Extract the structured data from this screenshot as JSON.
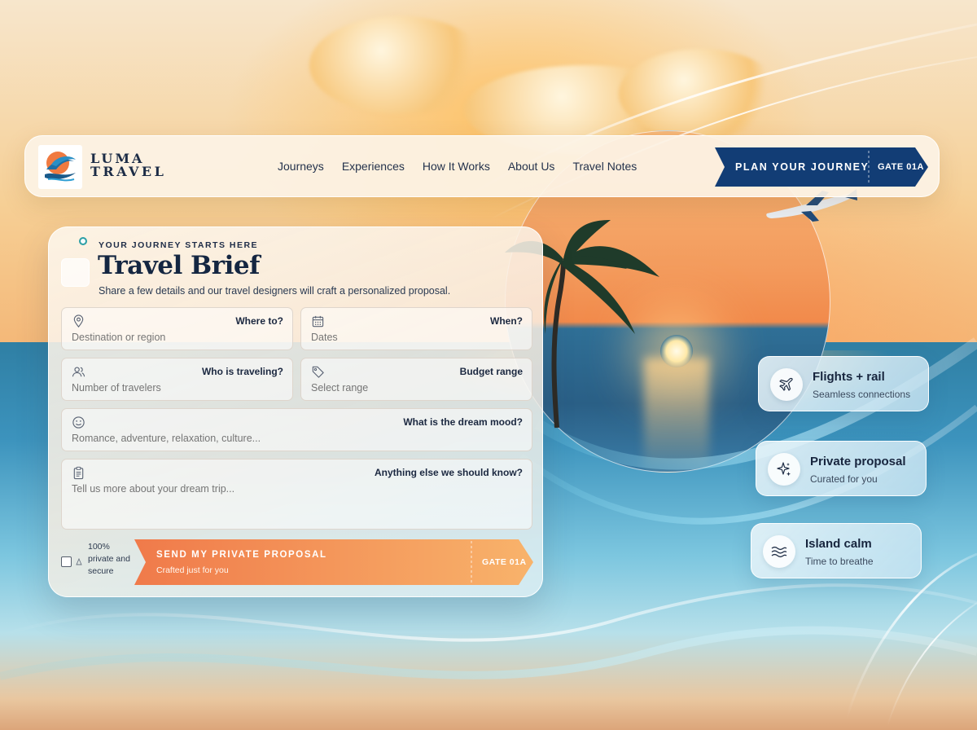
{
  "brand": {
    "line1": "LUMA",
    "line2": "TRAVEL"
  },
  "nav": {
    "items": [
      {
        "label": "Journeys"
      },
      {
        "label": "Experiences"
      },
      {
        "label": "How It Works"
      },
      {
        "label": "About Us"
      },
      {
        "label": "Travel Notes"
      }
    ]
  },
  "header_cta": {
    "label": "PLAN YOUR JOURNEY",
    "gate": "GATE 01A",
    "color": "#123d75"
  },
  "brief": {
    "eyebrow": "YOUR JOURNEY STARTS HERE",
    "title": "Travel Brief",
    "subtitle": "Share a few details and our travel designers will craft a personalized proposal.",
    "fields": {
      "where": {
        "label": "Where to?",
        "placeholder": "Destination or region",
        "icon": "map-pin-icon"
      },
      "when": {
        "label": "When?",
        "placeholder": "Dates",
        "icon": "calendar-icon"
      },
      "who": {
        "label": "Who is traveling?",
        "placeholder": "Number of travelers",
        "icon": "users-icon"
      },
      "budget": {
        "label": "Budget range",
        "placeholder": "Select range",
        "icon": "tag-icon"
      },
      "mood": {
        "label": "What is the dream mood?",
        "placeholder": "Romance, adventure, relaxation, culture...",
        "icon": "smile-icon"
      },
      "notes": {
        "label": "Anything else we should know?",
        "placeholder": "Tell us more about your dream trip...",
        "icon": "clipboard-icon"
      }
    },
    "consent": {
      "text": "100% private and secure",
      "checked": false
    },
    "submit": {
      "label": "SEND MY PRIVATE PROPOSAL",
      "sublabel": "Crafted just for you",
      "gate": "GATE 01A",
      "color_start": "#f07a4a",
      "color_end": "#f8b36b"
    }
  },
  "features": [
    {
      "title": "Flights + rail",
      "subtitle": "Seamless connections",
      "icon": "plane-icon"
    },
    {
      "title": "Private proposal",
      "subtitle": "Curated for you",
      "icon": "sparkle-icon"
    },
    {
      "title": "Island calm",
      "subtitle": "Time to breathe",
      "icon": "waves-icon"
    }
  ]
}
